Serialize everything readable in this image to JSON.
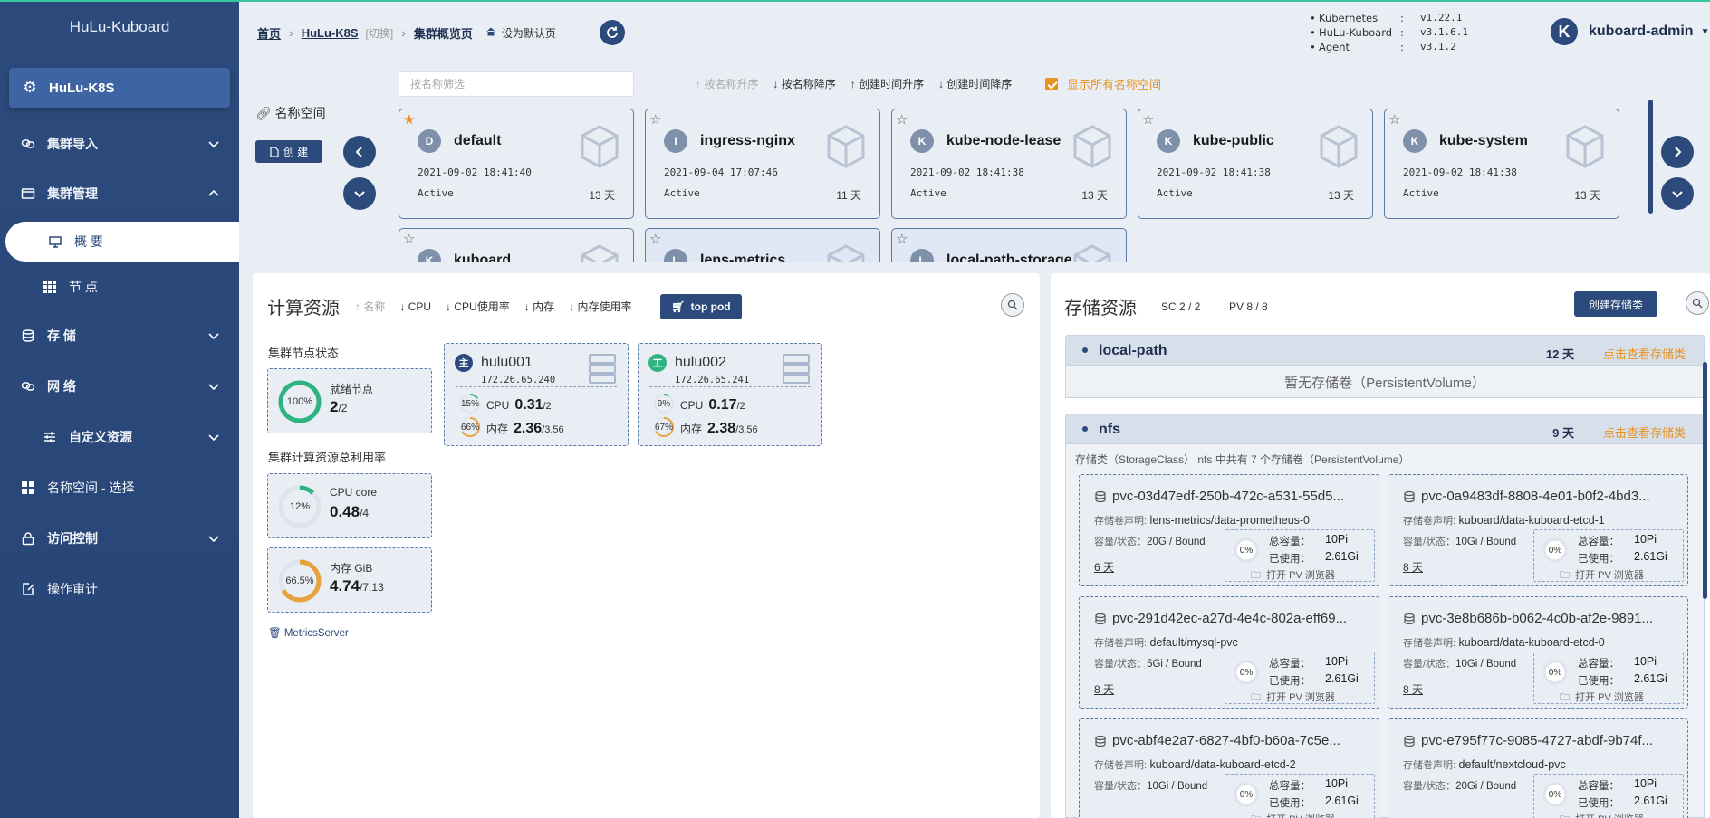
{
  "app_title": "HuLu-Kuboard",
  "cluster_name": "HuLu-K8S",
  "sidebar": {
    "items": [
      {
        "label": "集群导入",
        "icon": "link-icon"
      },
      {
        "label": "集群管理",
        "icon": "folder-icon"
      },
      {
        "label": "概 要",
        "icon": "presentation-icon"
      },
      {
        "label": "节 点",
        "icon": "grid-icon"
      },
      {
        "label": "存 储",
        "icon": "database-icon"
      },
      {
        "label": "网 络",
        "icon": "network-icon"
      },
      {
        "label": "自定义资源",
        "icon": "sliders-icon"
      },
      {
        "label": "名称空间 - 选择",
        "icon": "grid-icon"
      },
      {
        "label": "访问控制",
        "icon": "lock-icon"
      },
      {
        "label": "操作审计",
        "icon": "edit-icon"
      }
    ]
  },
  "breadcrumb": {
    "home": "首页",
    "cluster": "HuLu-K8S",
    "switch": "[切换]",
    "current": "集群概览页",
    "set_default": "设为默认页"
  },
  "versions": [
    {
      "name": "Kubernetes",
      "value": "v1.22.1"
    },
    {
      "name": "HuLu-Kuboard",
      "value": "v3.1.6.1"
    },
    {
      "name": "Agent",
      "value": "v3.1.2"
    }
  ],
  "user": {
    "avatar": "K",
    "name": "kuboard-admin"
  },
  "namespace": {
    "label": "名称空间",
    "create": "创 建",
    "filter_placeholder": "按名称筛选",
    "sorts": [
      "按名称升序",
      "按名称降序",
      "创建时间升序",
      "创建时间降序"
    ],
    "show_all": "显示所有名称空间",
    "cards": [
      {
        "letter": "D",
        "name": "default",
        "created": "2021-09-02 18:41:40",
        "status": "Active",
        "age": "13 天",
        "starred": true
      },
      {
        "letter": "I",
        "name": "ingress-nginx",
        "created": "2021-09-04 17:07:46",
        "status": "Active",
        "age": "11 天",
        "starred": false
      },
      {
        "letter": "K",
        "name": "kube-node-lease",
        "created": "2021-09-02 18:41:38",
        "status": "Active",
        "age": "13 天",
        "starred": false
      },
      {
        "letter": "K",
        "name": "kube-public",
        "created": "2021-09-02 18:41:38",
        "status": "Active",
        "age": "13 天",
        "starred": false
      },
      {
        "letter": "K",
        "name": "kube-system",
        "created": "2021-09-02 18:41:38",
        "status": "Active",
        "age": "13 天",
        "starred": false
      },
      {
        "letter": "K",
        "name": "kuboard",
        "starred": false
      },
      {
        "letter": "L",
        "name": "lens-metrics",
        "starred": false
      },
      {
        "letter": "L",
        "name": "local-path-storage",
        "starred": false
      }
    ]
  },
  "compute": {
    "title": "计算资源",
    "sorts": [
      "名称",
      "CPU",
      "CPU使用率",
      "内存",
      "内存使用率"
    ],
    "top_pod": "top pod",
    "node_status_label": "集群节点状态",
    "ready": {
      "label": "就绪节点",
      "value": "2",
      "total": "/2",
      "pct": "100%",
      "fraction": 1.0
    },
    "usage_label": "集群计算资源总利用率",
    "cpu": {
      "label": "CPU core",
      "value": "0.48",
      "total": "/4",
      "pct": "12%",
      "fraction": 0.12
    },
    "mem": {
      "label": "内存 GiB",
      "value": "4.74",
      "total": "/7.13",
      "pct": "66.5%",
      "fraction": 0.665
    },
    "metrics_server": "MetricsServer",
    "nodes": [
      {
        "role": "主",
        "color": "#2c4a7c",
        "name": "hulu001",
        "ip": "172.26.65.240",
        "cpu_pct": "15%",
        "cpu_fraction": 0.15,
        "cpu_label": "CPU",
        "cpu_val": "0.31",
        "cpu_total": "/2",
        "mem_pct": "66%",
        "mem_fraction": 0.66,
        "mem_label": "内存",
        "mem_val": "2.36",
        "mem_total": "/3.56"
      },
      {
        "role": "工",
        "color": "#2fb381",
        "name": "hulu002",
        "ip": "172.26.65.241",
        "cpu_pct": "9%",
        "cpu_fraction": 0.09,
        "cpu_label": "CPU",
        "cpu_val": "0.17",
        "cpu_total": "/2",
        "mem_pct": "67%",
        "mem_fraction": 0.67,
        "mem_label": "内存",
        "mem_val": "2.38",
        "mem_total": "/3.56"
      }
    ]
  },
  "storage": {
    "title": "存储资源",
    "sc_count": "SC 2 / 2",
    "pv_count": "PV 8 / 8",
    "create": "创建存储类",
    "view_link": "点击查看存储类",
    "classes": [
      {
        "name": "local-path",
        "age": "12 天",
        "empty": "暂无存储卷（PersistentVolume）"
      },
      {
        "name": "nfs",
        "age": "9 天",
        "desc": "存储类（StorageClass） nfs 中共有 7 个存储卷（PersistentVolume）"
      }
    ],
    "claim_label": "存储卷声明:",
    "cap_label": "容量/状态：",
    "total_label": "总容量：",
    "used_label": "已使用：",
    "browse": "打开 PV 浏览器",
    "pvcs": [
      {
        "name": "pvc-03d47edf-250b-472c-a531-55d5...",
        "claim": "lens-metrics/data-prometheus-0",
        "cap": "20G / Bound",
        "age": "6 天",
        "pct": "0%",
        "total": "10Pi",
        "used": "2.61Gi"
      },
      {
        "name": "pvc-0a9483df-8808-4e01-b0f2-4bd3...",
        "claim": "kuboard/data-kuboard-etcd-1",
        "cap": "10Gi / Bound",
        "age": "8 天",
        "pct": "0%",
        "total": "10Pi",
        "used": "2.61Gi"
      },
      {
        "name": "pvc-291d42ec-a27d-4e4c-802a-eff69...",
        "claim": "default/mysql-pvc",
        "cap": "5Gi / Bound",
        "age": "8 天",
        "pct": "0%",
        "total": "10Pi",
        "used": "2.61Gi"
      },
      {
        "name": "pvc-3e8b686b-b062-4c0b-af2e-9891...",
        "claim": "kuboard/data-kuboard-etcd-0",
        "cap": "10Gi / Bound",
        "age": "8 天",
        "pct": "0%",
        "total": "10Pi",
        "used": "2.61Gi"
      },
      {
        "name": "pvc-abf4e2a7-6827-4bf0-b60a-7c5e...",
        "claim": "kuboard/data-kuboard-etcd-2",
        "cap": "10Gi / Bound",
        "age": "",
        "pct": "0%",
        "total": "10Pi",
        "used": "2.61Gi"
      },
      {
        "name": "pvc-e795f77c-9085-4727-abdf-9b74f...",
        "claim": "default/nextcloud-pvc",
        "cap": "20Gi / Bound",
        "age": "",
        "pct": "0%",
        "total": "10Pi",
        "used": "2.61Gi"
      }
    ]
  },
  "colors": {
    "primary": "#2c4a7c",
    "accent": "#e6931f",
    "ring_green": "#2fb381",
    "ring_orange": "#e6a23c"
  }
}
